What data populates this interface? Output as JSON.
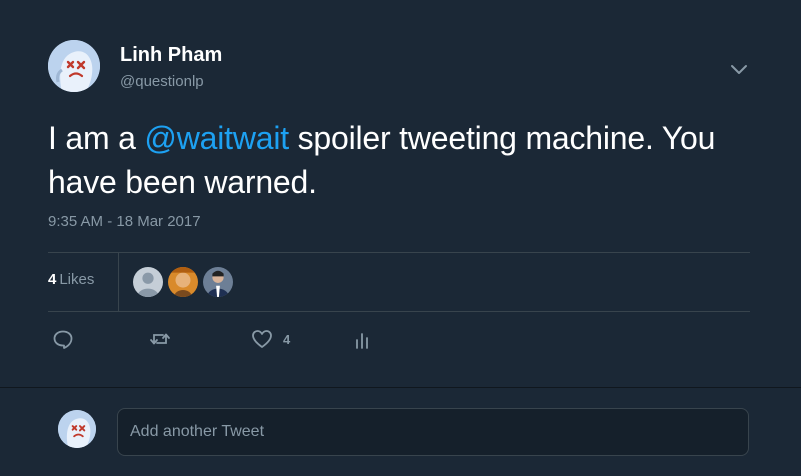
{
  "tweet": {
    "author_name": "Linh Pham",
    "author_handle": "@questionlp",
    "text_before": "I am a ",
    "mention": "@waitwait",
    "text_after": " spoiler tweeting machine. You have been warned.",
    "timestamp": "9:35 AM - 18 Mar 2017"
  },
  "stats": {
    "likes_count": "4",
    "likes_label": "Likes",
    "likers": [
      "default-avatar",
      "person-avatar",
      "person-in-suit-avatar"
    ]
  },
  "actions": {
    "reply_icon": "reply-icon",
    "retweet_icon": "retweet-icon",
    "like_icon": "heart-icon",
    "like_count": "4",
    "analytics_icon": "analytics-icon"
  },
  "reply": {
    "placeholder": "Add another Tweet"
  },
  "colors": {
    "background": "#1b2836",
    "accent": "#1da1f2",
    "muted": "#8899a6",
    "border": "#38444d"
  }
}
